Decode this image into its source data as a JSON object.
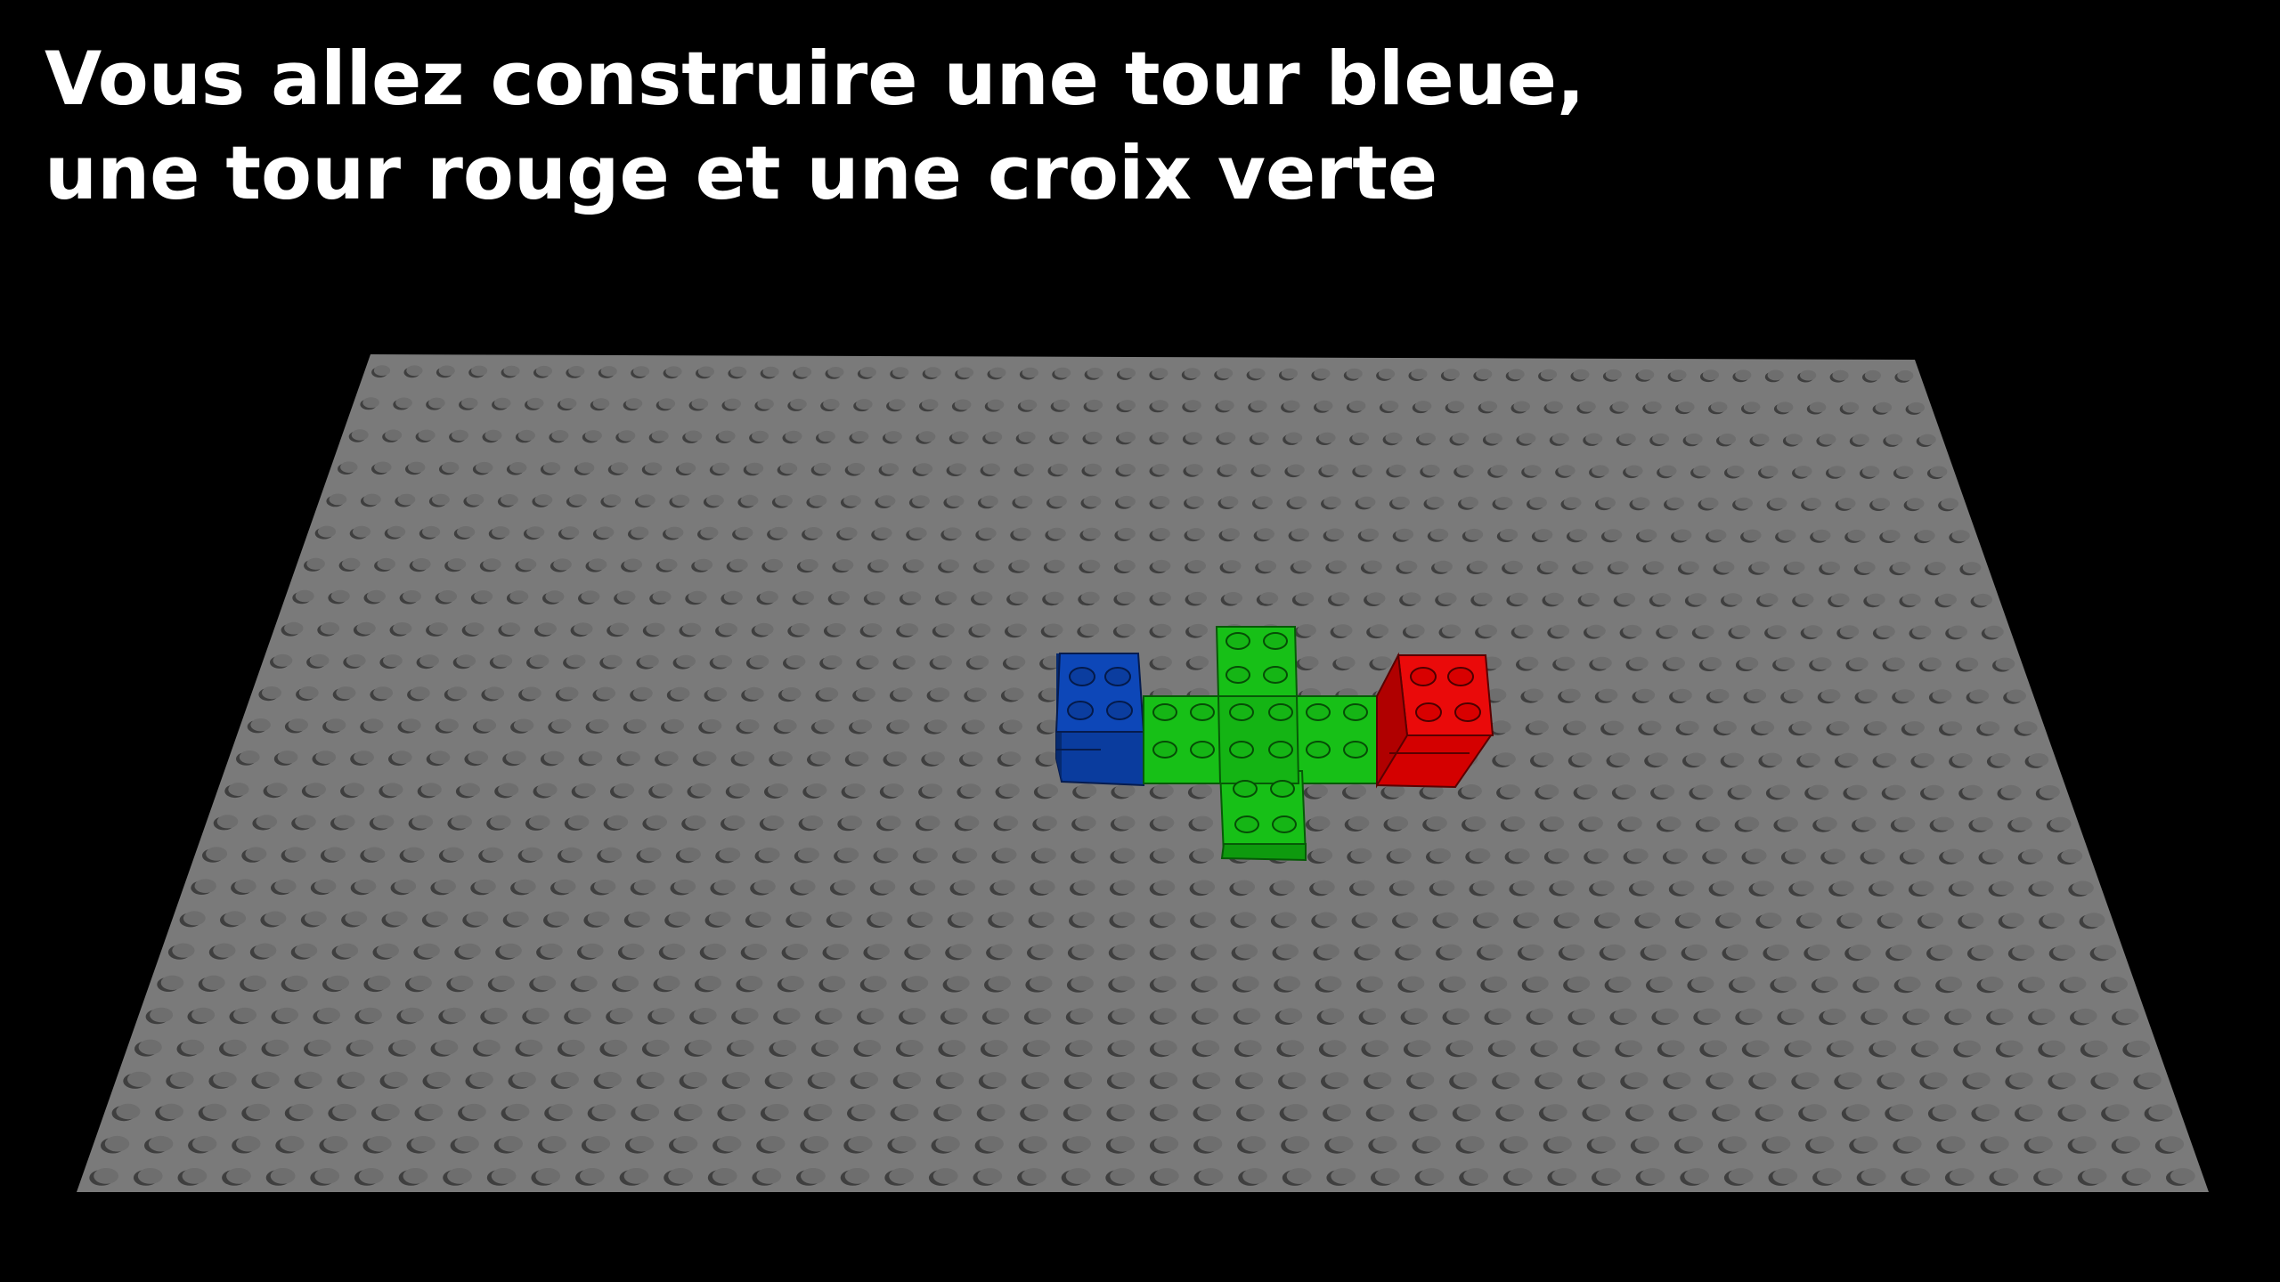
{
  "instruction": {
    "line1": "Vous allez construire une tour bleue,",
    "line2": "une tour rouge et une croix verte"
  },
  "colors": {
    "background": "#000000",
    "text": "#ffffff",
    "baseplate": "#7a7a7a",
    "blue_brick": "#0a3fa8",
    "green_brick": "#16c416",
    "red_brick": "#e00000"
  },
  "scene": {
    "baseplate": {
      "color_name": "gray",
      "stud_columns": 48,
      "stud_rows": 26
    },
    "structures": [
      {
        "name": "blue tower",
        "color": "blue",
        "bricks": 2
      },
      {
        "name": "green cross",
        "color": "green",
        "bricks": 3
      },
      {
        "name": "red tower",
        "color": "red",
        "bricks": 2
      }
    ]
  }
}
